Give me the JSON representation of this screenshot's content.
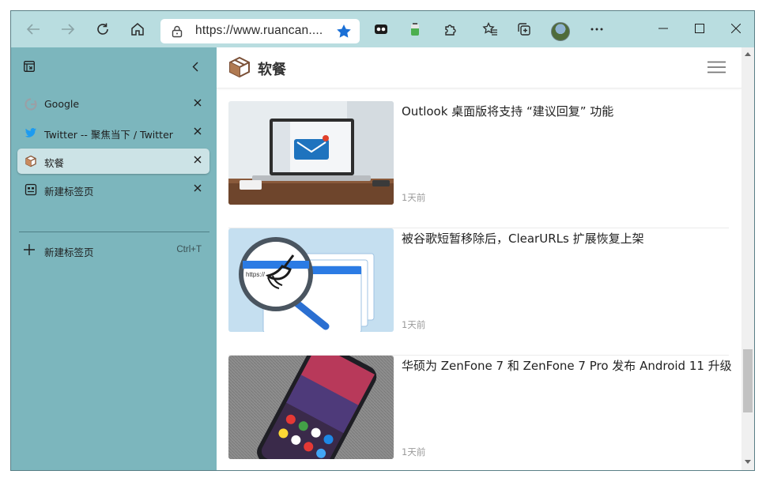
{
  "browser": {
    "url": "https://www.ruancan....",
    "colors": {
      "toolbar": "#b9dde0",
      "sidebar": "#7cb6bd",
      "accent": "#1a6fd6"
    }
  },
  "toolbar_icons": [
    "back-arrow-icon",
    "forward-arrow-icon",
    "refresh-icon",
    "home-icon",
    "lock-icon",
    "favorite-star-icon",
    "extension-icon",
    "puzzle-icon",
    "favorites-icon",
    "collections-icon",
    "profile-avatar",
    "more-icon"
  ],
  "tabs": [
    {
      "title": "Google",
      "icon": "google-icon",
      "active": false
    },
    {
      "title": "Twitter -- 聚焦当下 / Twitter",
      "icon": "twitter-icon",
      "active": false
    },
    {
      "title": "软餐",
      "icon": "ruancan-icon",
      "active": true
    },
    {
      "title": "新建标签页",
      "icon": "new-tab-page-icon",
      "active": false
    }
  ],
  "new_tab": {
    "label": "新建标签页",
    "shortcut": "Ctrl+T"
  },
  "site": {
    "name": "软餐"
  },
  "articles": [
    {
      "title": "Outlook 桌面版将支持 “建议回复” 功能",
      "time": "1天前"
    },
    {
      "title": "被谷歌短暂移除后，ClearURLs 扩展恢复上架",
      "time": "1天前"
    },
    {
      "title": "华硕为 ZenFone 7 和 ZenFone 7 Pro 发布 Android 11 升级",
      "time": "1天前"
    }
  ]
}
